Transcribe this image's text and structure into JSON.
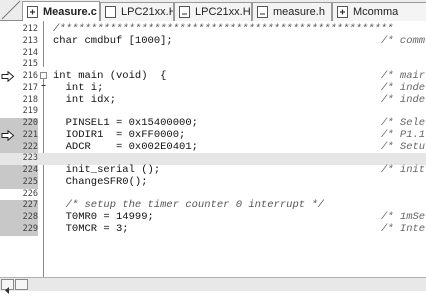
{
  "tabs": [
    {
      "label": "Measure.c",
      "active": true,
      "icon": "c-source-file-icon"
    },
    {
      "label": "LPC21xx.H",
      "active": false,
      "icon": "header-file-icon"
    },
    {
      "label": "LPC21xx.H",
      "active": false,
      "icon": "header-file-icon"
    },
    {
      "label": "measure.h",
      "active": false,
      "icon": "header-file-icon"
    },
    {
      "label": "Mcomma",
      "active": false,
      "icon": "c-source-file-icon"
    }
  ],
  "lines": [
    {
      "num": "212",
      "code": "/*****************************************************",
      "comment": ""
    },
    {
      "num": "213",
      "code": "char cmdbuf [1000];",
      "comment": "/* comm"
    },
    {
      "num": "214",
      "code": "",
      "comment": ""
    },
    {
      "num": "215",
      "code": "",
      "comment": ""
    },
    {
      "num": "216",
      "code": "int main (void)  {",
      "comment": "/* mair"
    },
    {
      "num": "217",
      "code": "  int i;",
      "comment": "/* inde"
    },
    {
      "num": "218",
      "code": "  int idx;",
      "comment": "/* inde"
    },
    {
      "num": "219",
      "code": "",
      "comment": ""
    },
    {
      "num": "220",
      "code": "  PINSEL1 = 0x15400000;",
      "comment": "/* Sele"
    },
    {
      "num": "221",
      "code": "  IODIR1  = 0xFF0000;",
      "comment": "/* P1.1"
    },
    {
      "num": "222",
      "code": "  ADCR    = 0x002E0401;",
      "comment": "/* Setu"
    },
    {
      "num": "223",
      "code": "",
      "comment": ""
    },
    {
      "num": "224",
      "code": "  init_serial ();",
      "comment": "/* init"
    },
    {
      "num": "225",
      "code": "  ChangeSFR0();",
      "comment": ""
    },
    {
      "num": "226",
      "code": "",
      "comment": ""
    },
    {
      "num": "227",
      "code": "  /* setup the timer counter 0 interrupt */",
      "comment": ""
    },
    {
      "num": "228",
      "code": "  T0MR0 = 14999;",
      "comment": "/* 1mSe"
    },
    {
      "num": "229",
      "code": "  T0MCR = 3;",
      "comment": "/* Inte"
    }
  ],
  "colors": {
    "current_line": "#e6e6e6",
    "highlight_gutter": "#c8c8c8"
  }
}
